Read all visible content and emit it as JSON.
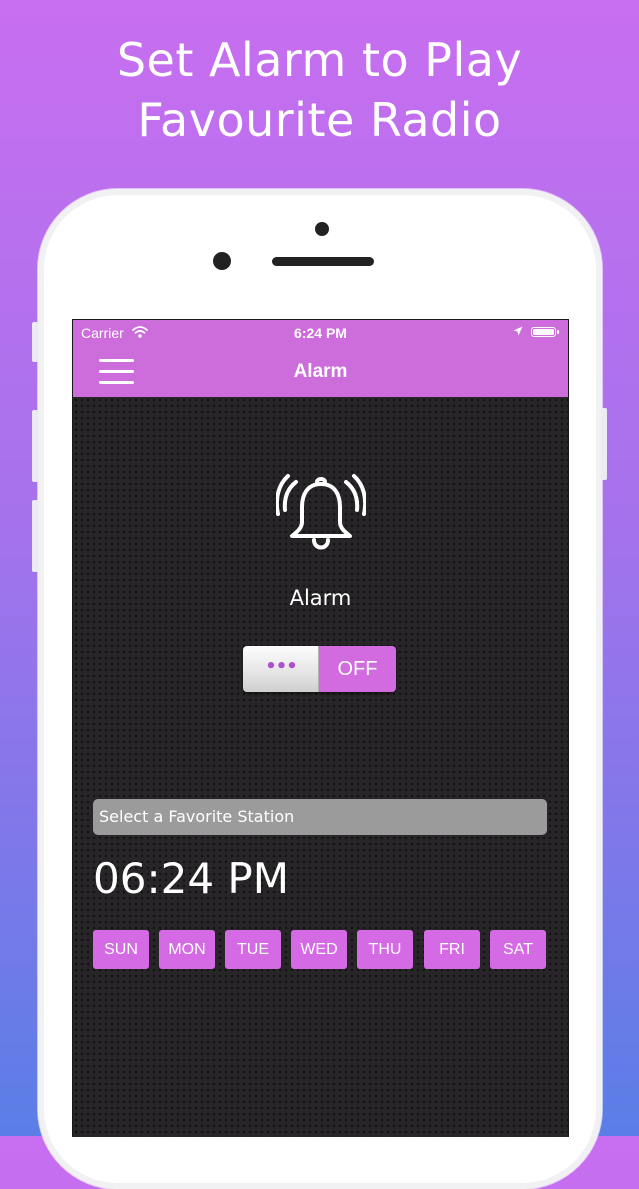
{
  "promo": {
    "line1": "Set Alarm to Play",
    "line2": "Favourite Radio"
  },
  "status_bar": {
    "carrier": "Carrier",
    "time": "6:24 PM",
    "icons": [
      "wifi-icon",
      "location-arrow-icon",
      "battery-icon"
    ]
  },
  "nav": {
    "title": "Alarm",
    "menu_icon": "hamburger-menu-icon"
  },
  "alarm": {
    "icon": "ringing-bell-icon",
    "label": "Alarm",
    "toggle_knob": "•••",
    "toggle_state": "OFF"
  },
  "station": {
    "placeholder": "Select a Favorite Station"
  },
  "time": "06:24 PM",
  "days": [
    "SUN",
    "MON",
    "TUE",
    "WED",
    "THU",
    "FRI",
    "SAT"
  ],
  "colors": {
    "accent": "#cc6ddb",
    "day_button": "#d46ae4",
    "screen_bg": "#262426",
    "select_bg": "#9b9b9b"
  }
}
